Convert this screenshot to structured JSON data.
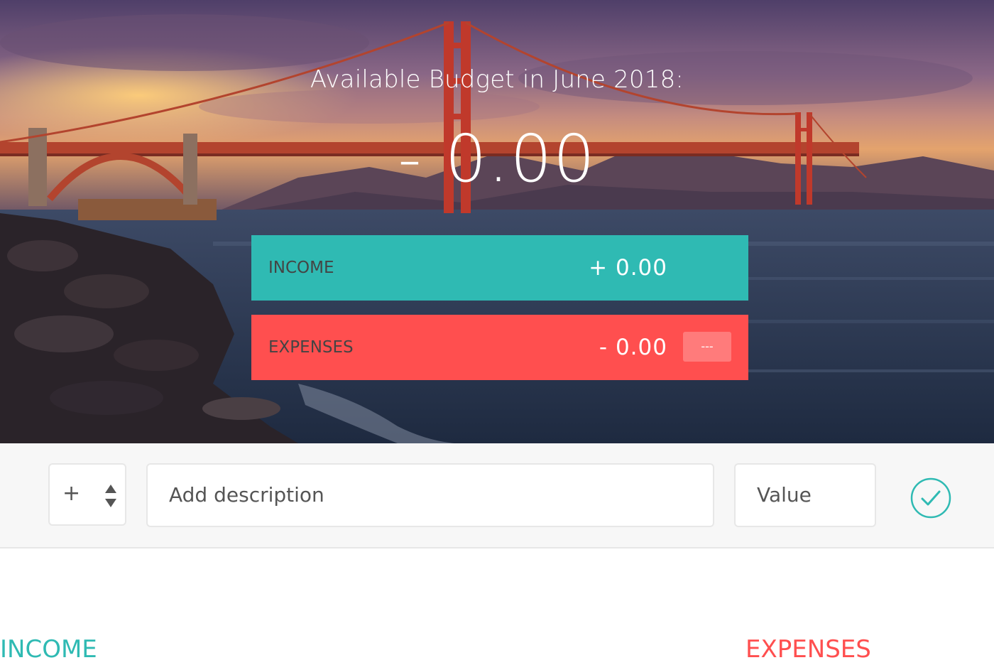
{
  "header": {
    "title": "Available Budget in June 2018:",
    "budget_value": "- 0.00"
  },
  "summary": {
    "income": {
      "label": "INCOME",
      "value": "+ 0.00"
    },
    "expenses": {
      "label": "EXPENSES",
      "value": "- 0.00",
      "percentage": "---"
    }
  },
  "add_form": {
    "type_value": "+",
    "description_placeholder": "Add description",
    "value_placeholder": "Value",
    "submit_icon": "checkmark-circle-icon"
  },
  "lists": {
    "income_title": "INCOME",
    "expenses_title": "EXPENSES"
  },
  "colors": {
    "income": "#2fbab3",
    "expenses": "#ff4f4f"
  }
}
